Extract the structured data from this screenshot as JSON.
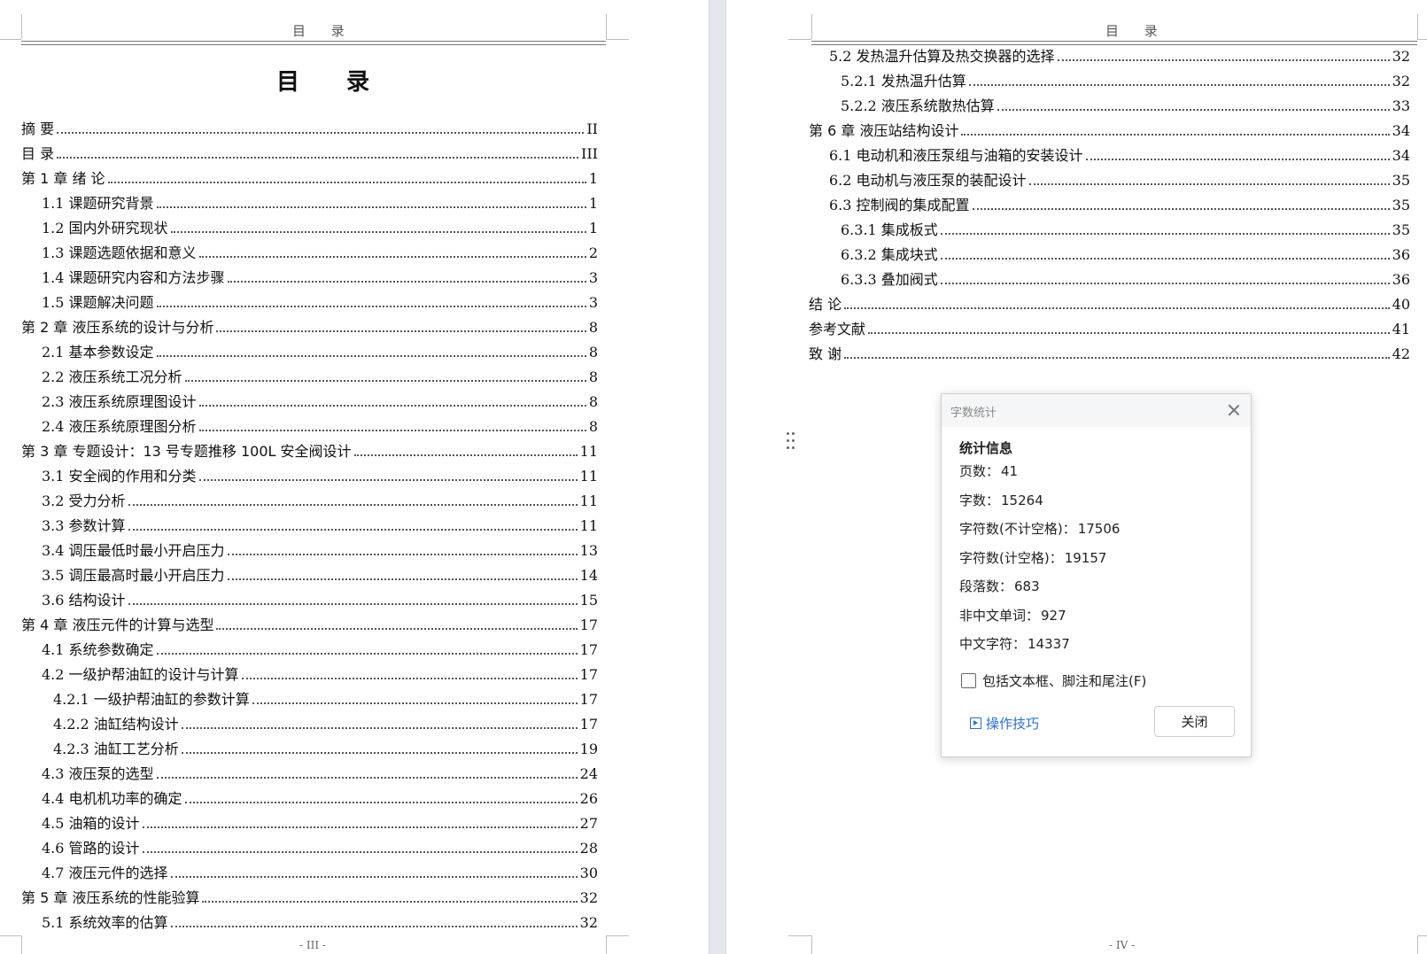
{
  "left_page": {
    "header": "目 录",
    "title": "目 录",
    "footer": "- III -",
    "toc": [
      {
        "text": "摘 要",
        "page": "II",
        "level": 0
      },
      {
        "text": "目 录",
        "page": "III",
        "level": 0
      },
      {
        "text": "第 1 章 绪 论",
        "page": "1",
        "level": 0
      },
      {
        "text": "1.1 课题研究背景",
        "page": "1",
        "level": 1
      },
      {
        "text": "1.2 国内外研究现状",
        "page": "1",
        "level": 1
      },
      {
        "text": "1.3 课题选题依据和意义",
        "page": "2",
        "level": 1
      },
      {
        "text": "1.4 课题研究内容和方法步骤",
        "page": "3",
        "level": 1
      },
      {
        "text": "1.5 课题解决问题",
        "page": "3",
        "level": 1
      },
      {
        "text": "第 2 章 液压系统的设计与分析",
        "page": "8",
        "level": 0
      },
      {
        "text": "2.1 基本参数设定",
        "page": "8",
        "level": 1
      },
      {
        "text": "2.2 液压系统工况分析",
        "page": "8",
        "level": 1
      },
      {
        "text": "2.3 液压系统原理图设计",
        "page": "8",
        "level": 1
      },
      {
        "text": "2.4 液压系统原理图分析",
        "page": "8",
        "level": 1
      },
      {
        "text": "第 3 章 专题设计：13 号专题推移 100L 安全阀设计",
        "page": "11",
        "level": 0
      },
      {
        "text": "3.1 安全阀的作用和分类",
        "page": "11",
        "level": 1
      },
      {
        "text": "3.2 受力分析",
        "page": "11",
        "level": 1
      },
      {
        "text": "3.3 参数计算",
        "page": "11",
        "level": 1
      },
      {
        "text": "3.4 调压最低时最小开启压力",
        "page": "13",
        "level": 1
      },
      {
        "text": "3.5 调压最高时最小开启压力",
        "page": "14",
        "level": 1
      },
      {
        "text": "3.6 结构设计",
        "page": "15",
        "level": 1
      },
      {
        "text": "第 4 章 液压元件的计算与选型",
        "page": "17",
        "level": 0
      },
      {
        "text": "4.1 系统参数确定",
        "page": "17",
        "level": 1
      },
      {
        "text": "4.2 一级护帮油缸的设计与计算",
        "page": "17",
        "level": 1
      },
      {
        "text": "4.2.1 一级护帮油缸的参数计算",
        "page": "17",
        "level": 2
      },
      {
        "text": "4.2.2 油缸结构设计",
        "page": "17",
        "level": 2
      },
      {
        "text": "4.2.3 油缸工艺分析",
        "page": "19",
        "level": 2
      },
      {
        "text": "4.3 液压泵的选型",
        "page": "24",
        "level": 1
      },
      {
        "text": "4.4 电机机功率的确定",
        "page": "26",
        "level": 1
      },
      {
        "text": "4.5 油箱的设计",
        "page": "27",
        "level": 1
      },
      {
        "text": "4.6 管路的设计",
        "page": "28",
        "level": 1
      },
      {
        "text": "4.7 液压元件的选择",
        "page": "30",
        "level": 1
      },
      {
        "text": "第 5 章 液压系统的性能验算",
        "page": "32",
        "level": 0
      },
      {
        "text": "5.1 系统效率的估算",
        "page": "32",
        "level": 1
      }
    ]
  },
  "right_page": {
    "header": "目 录",
    "footer": "- IV -",
    "toc": [
      {
        "text": "5.2 发热温升估算及热交换器的选择",
        "page": "32",
        "level": 1
      },
      {
        "text": "5.2.1 发热温升估算",
        "page": "32",
        "level": 2
      },
      {
        "text": "5.2.2 液压系统散热估算",
        "page": "33",
        "level": 2
      },
      {
        "text": "第 6 章 液压站结构设计",
        "page": "34",
        "level": 0
      },
      {
        "text": "6.1 电动机和液压泵组与油箱的安装设计",
        "page": "34",
        "level": 1
      },
      {
        "text": "6.2 电动机与液压泵的装配设计",
        "page": "35",
        "level": 1
      },
      {
        "text": "6.3 控制阀的集成配置",
        "page": "35",
        "level": 1
      },
      {
        "text": "6.3.1 集成板式",
        "page": "35",
        "level": 2
      },
      {
        "text": "6.3.2 集成块式",
        "page": "36",
        "level": 2
      },
      {
        "text": "6.3.3 叠加阀式",
        "page": "36",
        "level": 2
      },
      {
        "text": "结 论",
        "page": "40",
        "level": 0
      },
      {
        "text": "参考文献",
        "page": "41",
        "level": 0
      },
      {
        "text": "致 谢",
        "page": "42",
        "level": 0
      }
    ]
  },
  "dialog": {
    "title": "字数统计",
    "heading": "统计信息",
    "stats": [
      {
        "label": "页数：",
        "value": "41"
      },
      {
        "label": "字数：",
        "value": "15264"
      },
      {
        "label": "字符数(不计空格)：",
        "value": "17506"
      },
      {
        "label": "字符数(计空格)：",
        "value": "19157"
      },
      {
        "label": "段落数：",
        "value": "683"
      },
      {
        "label": "非中文单词：",
        "value": "927"
      },
      {
        "label": "中文字符：",
        "value": "14337"
      }
    ],
    "checkbox_label": "包括文本框、脚注和尾注(F)",
    "checkbox_checked": false,
    "tips_label": "操作技巧",
    "close_label": "关闭"
  },
  "icons": {
    "close": "close-icon",
    "tips": "play-box-icon",
    "drag": "drag-handle-icon",
    "checkbox": "checkbox-icon"
  },
  "colors": {
    "link": "#2b6fd1",
    "gutter": "#e3e7ec"
  }
}
